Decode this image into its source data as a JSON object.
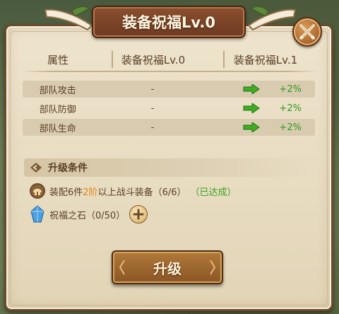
{
  "title": "装备祝福Lv.0",
  "headers": {
    "attr": "属性",
    "current": "装备祝福Lv.0",
    "next": "装备祝福Lv.1"
  },
  "rows": [
    {
      "name": "部队攻击",
      "current": "-",
      "next": "+2%"
    },
    {
      "name": "部队防御",
      "current": "-",
      "next": "+2%"
    },
    {
      "name": "部队生命",
      "current": "-",
      "next": "+2%"
    }
  ],
  "conditions": {
    "header": "升级条件",
    "equip": {
      "pre": "装配6件",
      "tier": "2阶",
      "post": "以上战斗装备（6/6）",
      "status": "（已达成）"
    },
    "stone": {
      "label": "祝福之石（0/50）"
    }
  },
  "upgrade_label": "升级",
  "colors": {
    "gain": "#2f9a1c",
    "accent": "#e0871a",
    "achieved": "#3aa322"
  },
  "icons": {
    "close": "close-crossed-swords-icon",
    "arrow": "green-arrow-icon",
    "equip": "helmet-icon",
    "stone": "crystal-icon",
    "plus": "plus-icon"
  }
}
